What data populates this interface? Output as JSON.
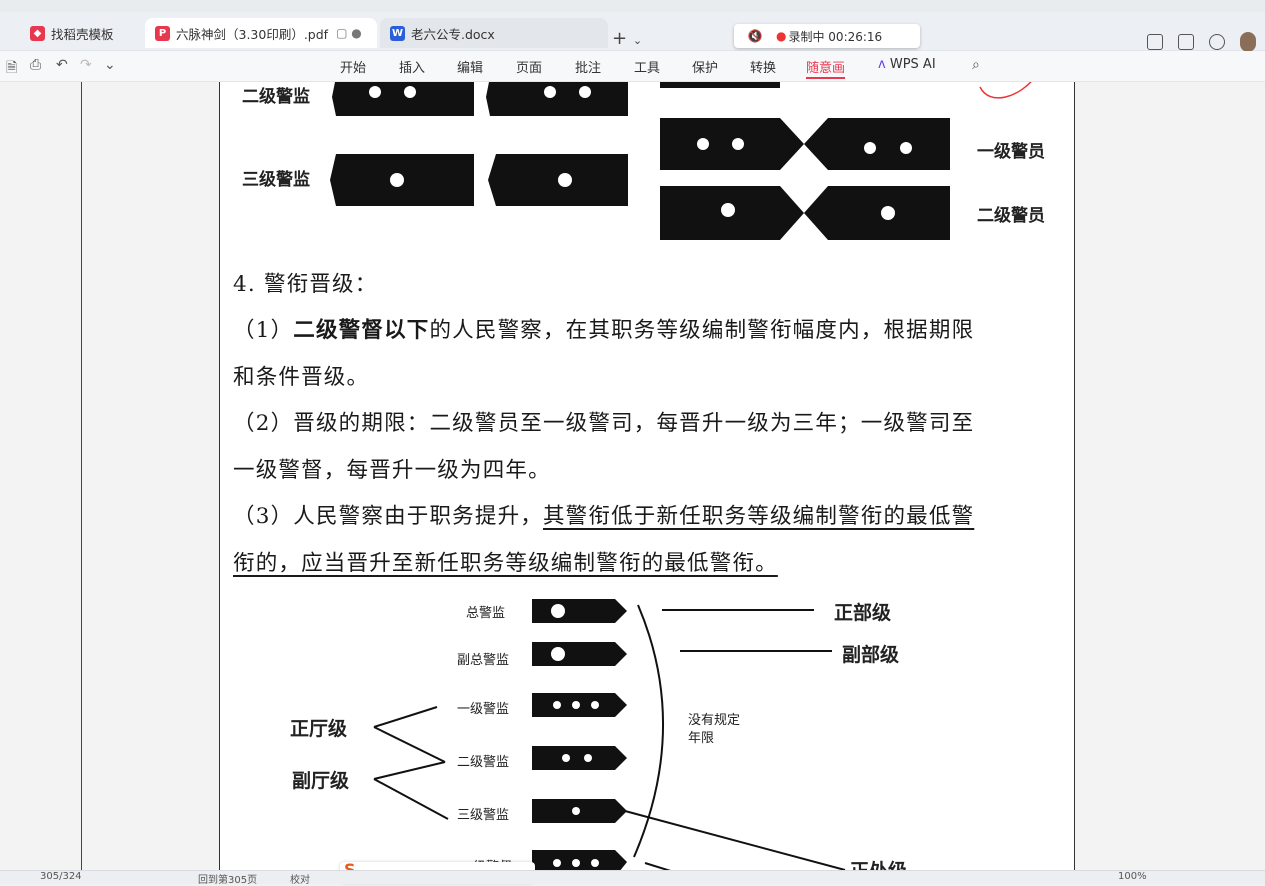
{
  "tabs": [
    {
      "label": "找稻壳模板",
      "icon": "docer-icon",
      "color": "#e8384f",
      "active": false
    },
    {
      "label": "六脉神剑（3.30印刷）.pdf",
      "icon": "pdf-icon",
      "color": "#e8384f",
      "active": true
    },
    {
      "label": "老六公专.docx",
      "icon": "word-icon",
      "color": "#2b5fd9",
      "active": false
    }
  ],
  "new_tab": "+",
  "recording": {
    "label": "录制中 00:26:16"
  },
  "menu": [
    "开始",
    "插入",
    "编辑",
    "页面",
    "批注",
    "工具",
    "保护",
    "转换",
    "随意画",
    "WPS AI"
  ],
  "active_menu": "随意画",
  "accent": "#e8384f",
  "doc": {
    "badges_top": {
      "left": [
        "二级警监",
        "三级警监"
      ],
      "right": [
        "一级警员",
        "二级警员"
      ]
    },
    "heading": "4. 警衔晋级：",
    "p1_prefix": "（1）",
    "p1_bold": "二级警督以下",
    "p1_rest": "的人民警察，在其职务等级编制警衔幅度内，根据期限",
    "p1_line2": "和条件晋级。",
    "p2_line1": "（2）晋级的期限：二级警员至一级警司，每晋升一级为三年；一级警司至",
    "p2_line2": "一级警督，每晋升一级为四年。",
    "p3_prefix": "（3）人民警察由于职务提升，",
    "p3_under1": "其警衔低于新任职务等级编制警衔的最低警",
    "p3_under2": "衔的，应当晋升至新任职务等级编制警衔的最低警衔。",
    "diagram": {
      "ranks": [
        "总警监",
        "副总警监",
        "一级警监",
        "二级警监",
        "三级警监",
        "一级警督"
      ],
      "levels_right": [
        "正部级",
        "副部级",
        "正处级"
      ],
      "levels_left": [
        "正厅级",
        "副厅级"
      ],
      "note": "没有规定\n年限"
    }
  },
  "status": {
    "page": "305/324",
    "back": "回到第305页",
    "note": "校对",
    "zoom": "100%"
  }
}
